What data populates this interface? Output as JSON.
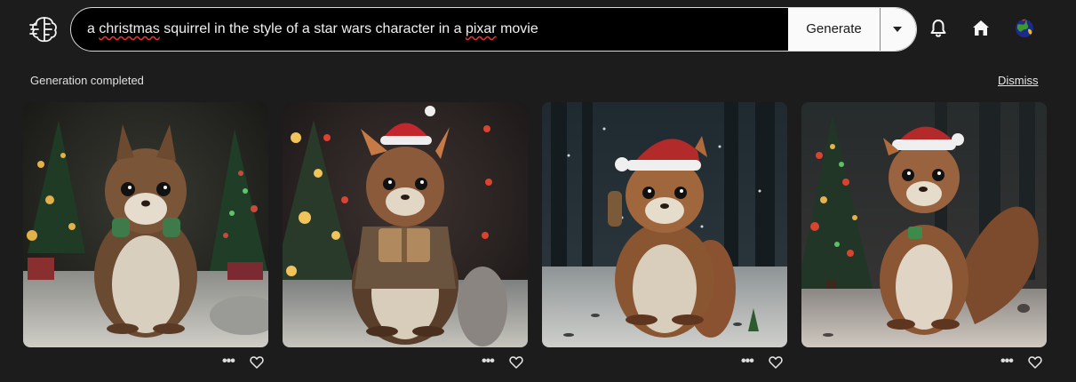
{
  "search": {
    "prompt_parts": [
      "a ",
      "christmas",
      " squirrel in the style of a star wars character in a ",
      "pixar",
      " movie"
    ],
    "generate_label": "Generate"
  },
  "status": {
    "message": "Generation completed",
    "dismiss_label": "Dismiss"
  },
  "icons": {
    "logo": "brain-logo",
    "notifications": "bell-icon",
    "home": "home-icon",
    "avatar": "globe-avatar",
    "more": "more-dots-icon",
    "favorite": "heart-icon"
  },
  "images": [
    {
      "subject": "squirrel-1"
    },
    {
      "subject": "squirrel-2"
    },
    {
      "subject": "squirrel-3"
    },
    {
      "subject": "squirrel-4"
    }
  ],
  "colors": {
    "background": "#1c1c1c",
    "search_bg": "#000000",
    "button_bg": "#fafafa"
  }
}
